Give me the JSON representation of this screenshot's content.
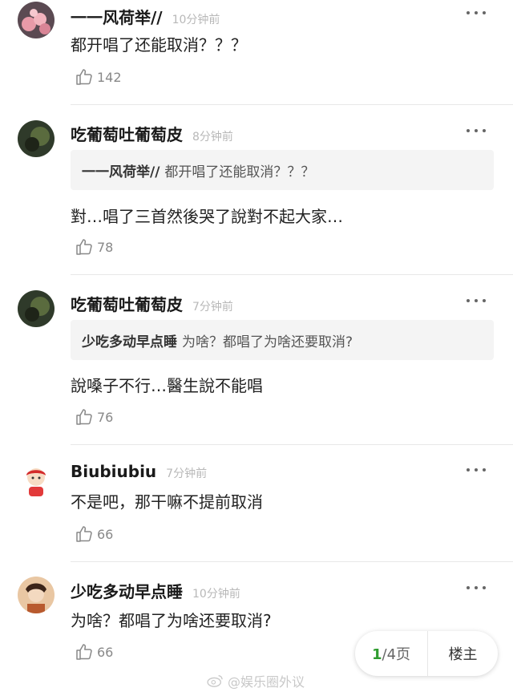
{
  "comments": [
    {
      "username": "一一风荷举//",
      "time": "10分钟前",
      "text": "都开唱了还能取消？？？",
      "likes": "142"
    },
    {
      "username": "吃葡萄吐葡萄皮",
      "time": "8分钟前",
      "quote_user": "一一风荷举//",
      "quote_text": "都开唱了还能取消？？？",
      "text": "對…唱了三首然後哭了說對不起大家…",
      "likes": "78"
    },
    {
      "username": "吃葡萄吐葡萄皮",
      "time": "7分钟前",
      "quote_user": "少吃多动早点睡",
      "quote_text": "为啥？都唱了为啥还要取消?",
      "text": "說嗓子不行…醫生說不能唱",
      "likes": "76"
    },
    {
      "username": "Biubiubiu",
      "time": "7分钟前",
      "text": "不是吧，那干嘛不提前取消",
      "likes": "66"
    },
    {
      "username": "少吃多动早点睡",
      "time": "10分钟前",
      "text": "为啥？都唱了为啥还要取消?",
      "likes": "66"
    }
  ],
  "pager": {
    "current": "1",
    "total": "/4页",
    "host_label": "楼主"
  },
  "watermark": {
    "text": "@娱乐圈外议"
  },
  "colors": {
    "accent_green": "#2e9b2e",
    "time_gray": "#b8b8b8",
    "quote_bg": "#f4f4f4"
  }
}
